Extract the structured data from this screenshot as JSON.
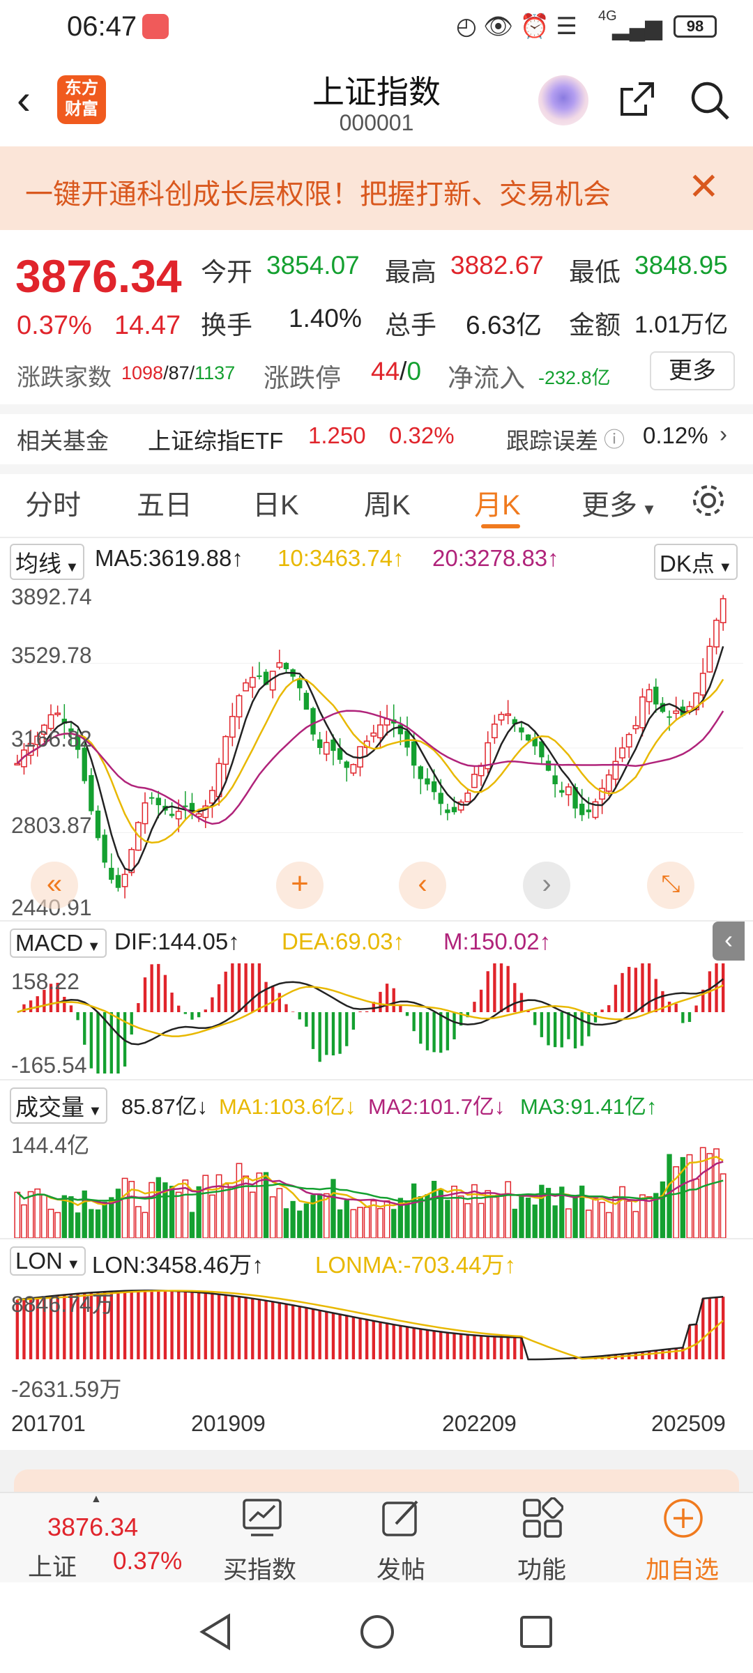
{
  "status": {
    "time": "06:47",
    "network": "4G",
    "battery": "98"
  },
  "header": {
    "title": "上证指数",
    "code": "000001",
    "logo_line1": "东方",
    "logo_line2": "财富"
  },
  "banner": {
    "text": "一键开通科创成长层权限！把握打新、交易机会"
  },
  "quote": {
    "price": "3876.34",
    "pct": "0.37%",
    "change": "14.47",
    "open_label": "今开",
    "open": "3854.07",
    "high_label": "最高",
    "high": "3882.67",
    "low_label": "最低",
    "low": "3848.95",
    "turnover_rate_label": "换手",
    "turnover_rate": "1.40%",
    "volume_label": "总手",
    "volume": "6.63亿",
    "amount_label": "金额",
    "amount": "1.01万亿",
    "breadth_label": "涨跌家数",
    "breadth_up": "1098",
    "breadth_flat": "87",
    "breadth_down": "1137",
    "limit_label": "涨跌停",
    "limit_up": "44",
    "limit_down": "0",
    "netflow_label": "净流入",
    "netflow": "-232.8亿",
    "more_label": "更多"
  },
  "fund": {
    "label": "相关基金",
    "name": "上证综指ETF",
    "price": "1.250",
    "pct": "0.32%",
    "track_label": "跟踪误差",
    "track_value": "0.12%"
  },
  "tabs": [
    {
      "label": "分时"
    },
    {
      "label": "五日"
    },
    {
      "label": "日K"
    },
    {
      "label": "周K"
    },
    {
      "label": "月K"
    },
    {
      "label": "更多"
    }
  ],
  "ma_legend": {
    "selector": "均线",
    "ma5": "MA5:3619.88",
    "ma10": "10:3463.74",
    "ma20": "20:3278.83",
    "dk": "DK点"
  },
  "price_axis": {
    "top": "3892.74",
    "upper": "3529.78",
    "mid": "3166.82",
    "lower": "2803.87",
    "bottom": "2440.91"
  },
  "macd_legend": {
    "selector": "MACD",
    "dif": "DIF:144.05",
    "dea": "DEA:69.03",
    "m": "M:150.02",
    "top": "158.22",
    "bottom": "-165.54"
  },
  "vol_legend": {
    "selector": "成交量",
    "value": "85.87亿",
    "ma1": "MA1:103.6亿",
    "ma2": "MA2:101.7亿",
    "ma3": "MA3:91.41亿",
    "top": "144.4亿"
  },
  "lon_legend": {
    "selector": "LON",
    "lon": "LON:3458.46万",
    "lonma": "LONMA:-703.44万",
    "top": "8846.74万",
    "bottom": "-2631.59万"
  },
  "x_axis": [
    "201701",
    "201909",
    "202209",
    "202509"
  ],
  "bottom_bar": {
    "index_price": "3876.34",
    "index_name": "上证",
    "index_pct": "0.37%",
    "buy": "买指数",
    "post": "发帖",
    "func": "功能",
    "add": "加自选"
  },
  "colors": {
    "up": "#e0242b",
    "down": "#14a030",
    "accent": "#f07a1e",
    "ma5": "#222222",
    "ma10": "#e8b800",
    "ma20": "#b0237a"
  }
}
